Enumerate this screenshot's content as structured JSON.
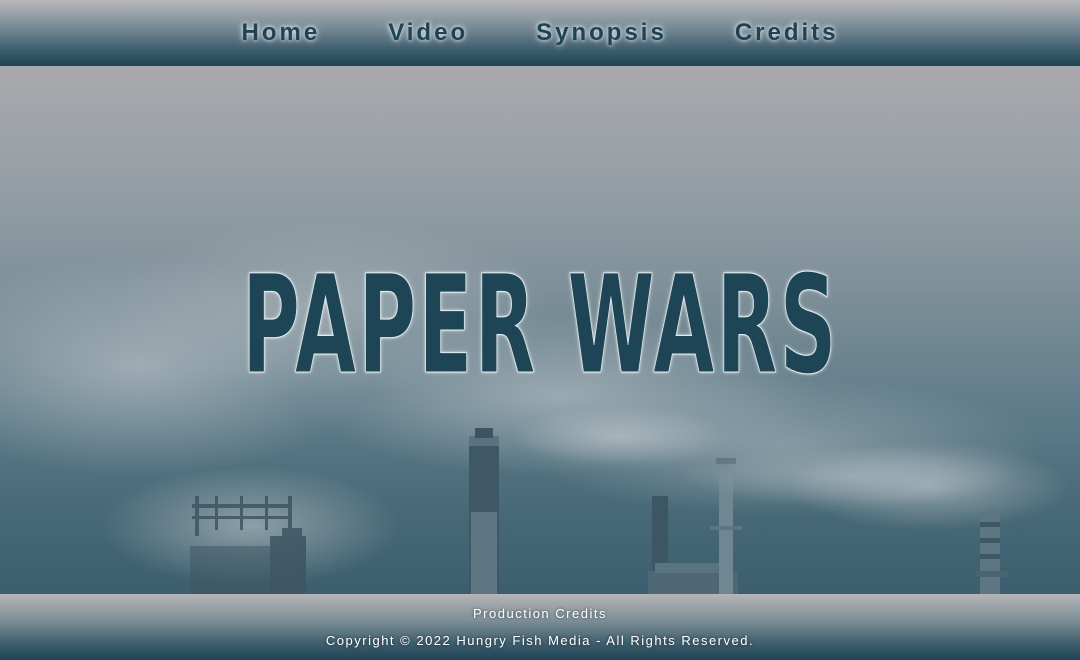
{
  "nav": {
    "items": [
      {
        "label": "Home"
      },
      {
        "label": "Video"
      },
      {
        "label": "Synopsis"
      },
      {
        "label": "Credits"
      }
    ]
  },
  "hero": {
    "title": "PAPER WARS",
    "background_image": "industrial-smokestacks-fog"
  },
  "footer": {
    "link_label": "Production Credits",
    "copyright": "Copyright © 2022 Hungry Fish Media - All Rights Reserved."
  },
  "colors": {
    "title": "#1d4556",
    "nav_text": "#1c4356",
    "bar_dark": "#1f4454",
    "footer_text": "#ffffff"
  }
}
